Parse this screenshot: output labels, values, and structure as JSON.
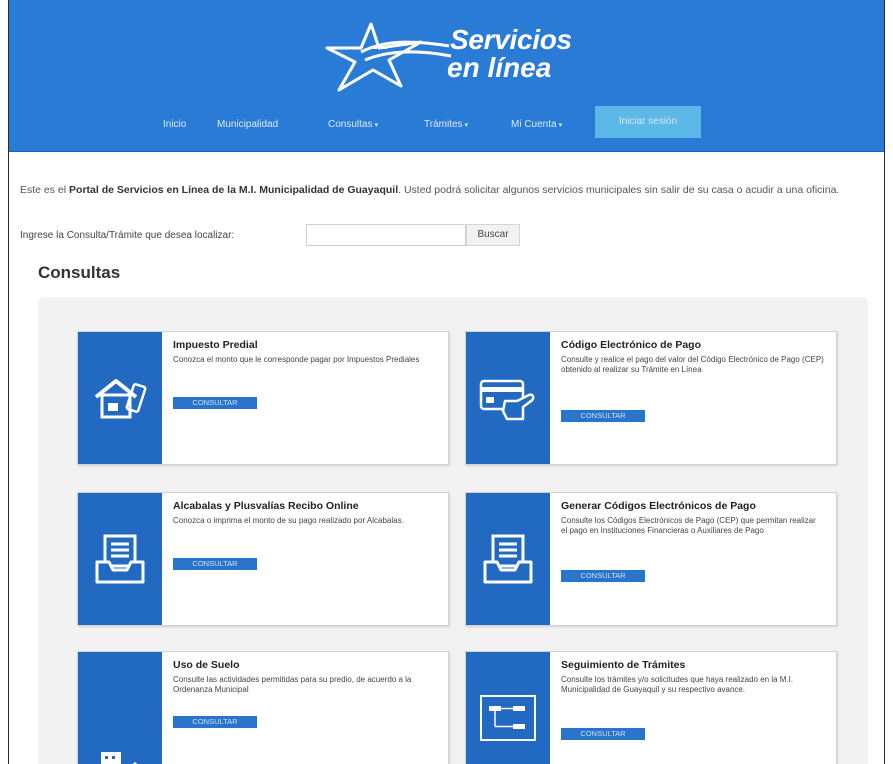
{
  "logo": {
    "line1": "Servicios",
    "line2": "en línea"
  },
  "nav": {
    "items": [
      {
        "label": "Inicio"
      },
      {
        "label": "Municipalidad"
      },
      {
        "label": "Consultas",
        "caret": "▾"
      },
      {
        "label": "Trámites",
        "caret": "▾"
      },
      {
        "label": "Mi Cuenta",
        "caret": "▾"
      }
    ],
    "login_label": "Iniciar sesión"
  },
  "intro": {
    "prefix": "Este es el ",
    "bold": "Portal de Servicios en Línea de la M.I. Municipalidad de Guayaquil",
    "suffix": ". Usted podrá solicitar algunos servicios municipales sin salir de su casa o acudir a una oficina."
  },
  "search": {
    "label": "Ingrese la Consulta/Trámite que desea localizar:",
    "value": "",
    "button_label": "Buscar"
  },
  "section_title": "Consultas",
  "cards": [
    {
      "title": "Impuesto Predial",
      "description": "Conozca el monto que le corresponde pagar por Impuestos Prediales",
      "button": "CONSULTAR",
      "icon": "house-icon"
    },
    {
      "title": "Código Electrónico de Pago",
      "description": "Consulte y realice el pago del valor del Código Electrónico de Pago (CEP) obtenido al realizar su Trámite en Línea",
      "button": "CONSULTAR",
      "icon": "credit-card-icon"
    },
    {
      "title": "Alcabalas y Plusvalías Recibo Online",
      "description": "Conozca o imprima el monto de su pago realizado por Alcabalas.",
      "button": "CONSULTAR",
      "icon": "inbox-document-icon"
    },
    {
      "title": "Generar Códigos Electrónicos de Pago",
      "description": "Consulte los Códigos Electrónicos de Pago (CEP) que permitan realizar el pago en Instituciones Financieras o Auxiliares de Pago",
      "button": "CONSULTAR",
      "icon": "inbox-document-icon"
    },
    {
      "title": "Uso de Suelo",
      "description": "Consulte las actividades permitidas para su predio, de acuerdo a la Ordenanza Municipal",
      "button": "CONSULTAR",
      "icon": "buildings-icon"
    },
    {
      "title": "Seguimiento de Trámites",
      "description": "Consulte los trámites y/o solicitudes que haya realizado en la M.I. Municipalidad de Guayaquil y su respectivo avance.",
      "button": "CONSULTAR",
      "icon": "flowchart-icon"
    }
  ],
  "colors": {
    "header": "#2a7bd6",
    "card_icon_bg": "#2169c1",
    "button": "#2a74cc",
    "login_button": "#5cb8e6"
  }
}
